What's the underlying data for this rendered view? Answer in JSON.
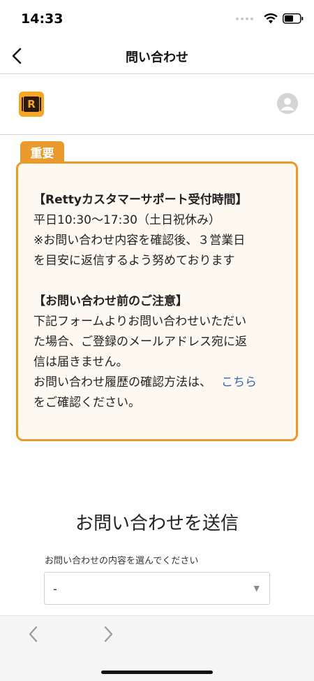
{
  "status_bar": {
    "time": "14:33"
  },
  "header": {
    "title": "問い合わせ",
    "back_icon": "chevron-left-icon"
  },
  "brand": {
    "logo_letter": "R",
    "logo_color": "#f5a623",
    "avatar_icon": "user-avatar-icon"
  },
  "notice": {
    "badge": "重要",
    "accent_color": "#ea9a2c",
    "section1_heading": "【Rettyカスタマーサポート受付時間】",
    "hours": "平日10:30〜17:30（土日祝休み）",
    "reply_line1": "※お問い合わせ内容を確認後、３営業日",
    "reply_line2": "を目安に返信するよう努めております",
    "section2_heading": "【お問い合わせ前のご注意】",
    "caution_line1": "下記フォームよりお問い合わせいただい",
    "caution_line2": "た場合、ご登録のメールアドレス宛に返",
    "caution_line3": "信は届きません。",
    "history_text": "お問い合わせ履歴の確認方法は、",
    "history_link": "こちら",
    "history_line2": "をご確認ください。",
    "link_color": "#2a6ab5"
  },
  "form": {
    "title": "お問い合わせを送信",
    "select_label": "お問い合わせの内容を選んでください",
    "select_value": "-"
  },
  "toolbar": {
    "back_icon": "chevron-left-icon",
    "forward_icon": "chevron-right-icon"
  }
}
